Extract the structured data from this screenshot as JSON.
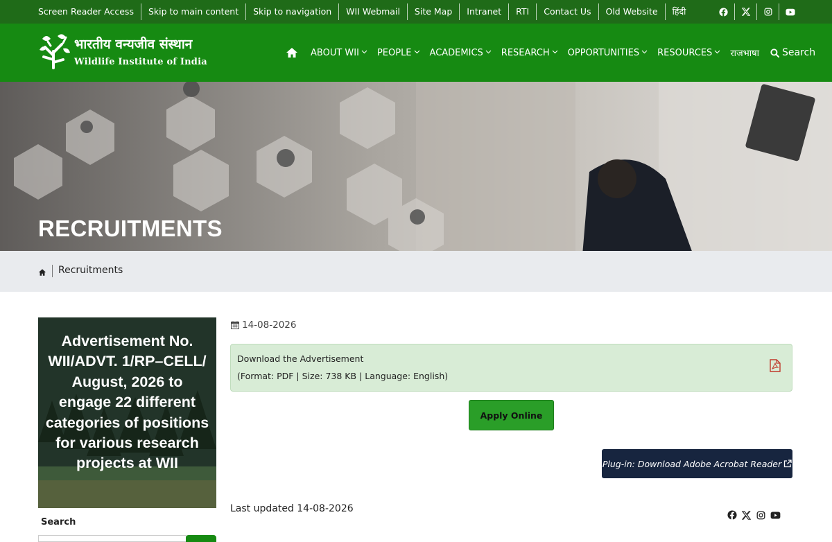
{
  "topbar": {
    "links": [
      "Screen Reader Access",
      "Skip to main content",
      "Skip to navigation",
      "WII Webmail",
      "Site Map",
      "Intranet",
      "RTI",
      "Contact Us",
      "Old Website",
      "हिंदी"
    ],
    "social_icons": [
      "facebook-icon",
      "x-icon",
      "instagram-icon",
      "youtube-icon"
    ]
  },
  "header": {
    "logo_hindi": "भारतीय वन्यजीव संस्थान",
    "logo_english": "Wildlife Institute of India",
    "nav": [
      {
        "label": "ABOUT WII",
        "dropdown": true
      },
      {
        "label": "PEOPLE",
        "dropdown": true
      },
      {
        "label": "ACADEMICS",
        "dropdown": true
      },
      {
        "label": "RESEARCH",
        "dropdown": true
      },
      {
        "label": "OPPORTUNITIES",
        "dropdown": true
      },
      {
        "label": "RESOURCES",
        "dropdown": true
      },
      {
        "label": "राजभाषा",
        "dropdown": false
      }
    ],
    "search_label": "Search"
  },
  "banner": {
    "title": "RECRUITMENTS"
  },
  "breadcrumb": {
    "current": "Recruitments"
  },
  "sidebar": {
    "card_text": "Advertisement No. WII/ADVT. 1/RP–CELL/ August, 2026 to engage 22 different categories of positions for various research projects at WII",
    "search_label": "Search"
  },
  "content": {
    "date": "14-08-2026",
    "download_title": "Download the Advertisement",
    "download_meta": "(Format: PDF | Size: 738 KB | Language: English)",
    "apply_label": "Apply Online",
    "plugin_label": "Plug-in: Download Adobe Acrobat Reader",
    "last_updated": "Last updated 14-08-2026"
  },
  "colors": {
    "topbar": "#1f6b18",
    "header": "#168a12",
    "apply_button": "#2a9e28",
    "plugin_button": "#17253f",
    "download_box": "#d8ecd6",
    "pdf_icon": "#c0392b"
  }
}
